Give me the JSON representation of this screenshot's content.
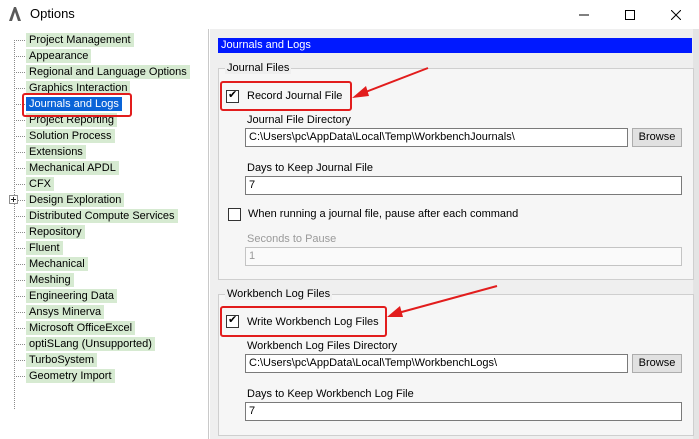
{
  "window": {
    "title": "Options",
    "app_icon": "ansys-logo-icon",
    "controls": [
      "minimize-icon",
      "maximize-icon",
      "close-icon"
    ]
  },
  "tree": {
    "items": [
      {
        "label": "Project Management"
      },
      {
        "label": "Appearance"
      },
      {
        "label": "Regional and Language Options"
      },
      {
        "label": "Graphics Interaction"
      },
      {
        "label": "Journals and Logs",
        "selected": true
      },
      {
        "label": "Project Reporting"
      },
      {
        "label": "Solution Process"
      },
      {
        "label": "Extensions"
      },
      {
        "label": "Mechanical APDL"
      },
      {
        "label": "CFX"
      },
      {
        "label": "Design Exploration",
        "expandable": true
      },
      {
        "label": "Distributed Compute Services"
      },
      {
        "label": "Repository"
      },
      {
        "label": "Fluent"
      },
      {
        "label": "Mechanical"
      },
      {
        "label": "Meshing"
      },
      {
        "label": "Engineering Data"
      },
      {
        "label": "Ansys Minerva"
      },
      {
        "label": "Microsoft OfficeExcel"
      },
      {
        "label": "optiSLang (Unsupported)"
      },
      {
        "label": "TurboSystem"
      },
      {
        "label": "Geometry Import"
      }
    ],
    "selected_color": "#0a64d8",
    "item_bg_color": "#d6ead1"
  },
  "panel": {
    "header": "Journals and Logs",
    "header_color": "#0019ff",
    "journal_files": {
      "group_title": "Journal Files",
      "record_checkbox_label": "Record Journal File",
      "record_checked": true,
      "directory_label": "Journal File Directory",
      "directory_value": "C:\\Users\\pc\\AppData\\Local\\Temp\\WorkbenchJournals\\",
      "browse_label": "Browse",
      "days_label": "Days to Keep Journal File",
      "days_value": "7",
      "pause_checkbox_label": "When running a journal file, pause after each command",
      "pause_checked": false,
      "seconds_label": "Seconds to Pause",
      "seconds_value": "1"
    },
    "log_files": {
      "group_title": "Workbench Log Files",
      "write_checkbox_label": "Write Workbench Log Files",
      "write_checked": true,
      "directory_label": "Workbench Log Files Directory",
      "directory_value": "C:\\Users\\pc\\AppData\\Local\\Temp\\WorkbenchLogs\\",
      "browse_label": "Browse",
      "days_label": "Days to Keep Workbench Log File",
      "days_value": "7"
    }
  },
  "annotations": {
    "highlight_color": "#e21d1d"
  }
}
